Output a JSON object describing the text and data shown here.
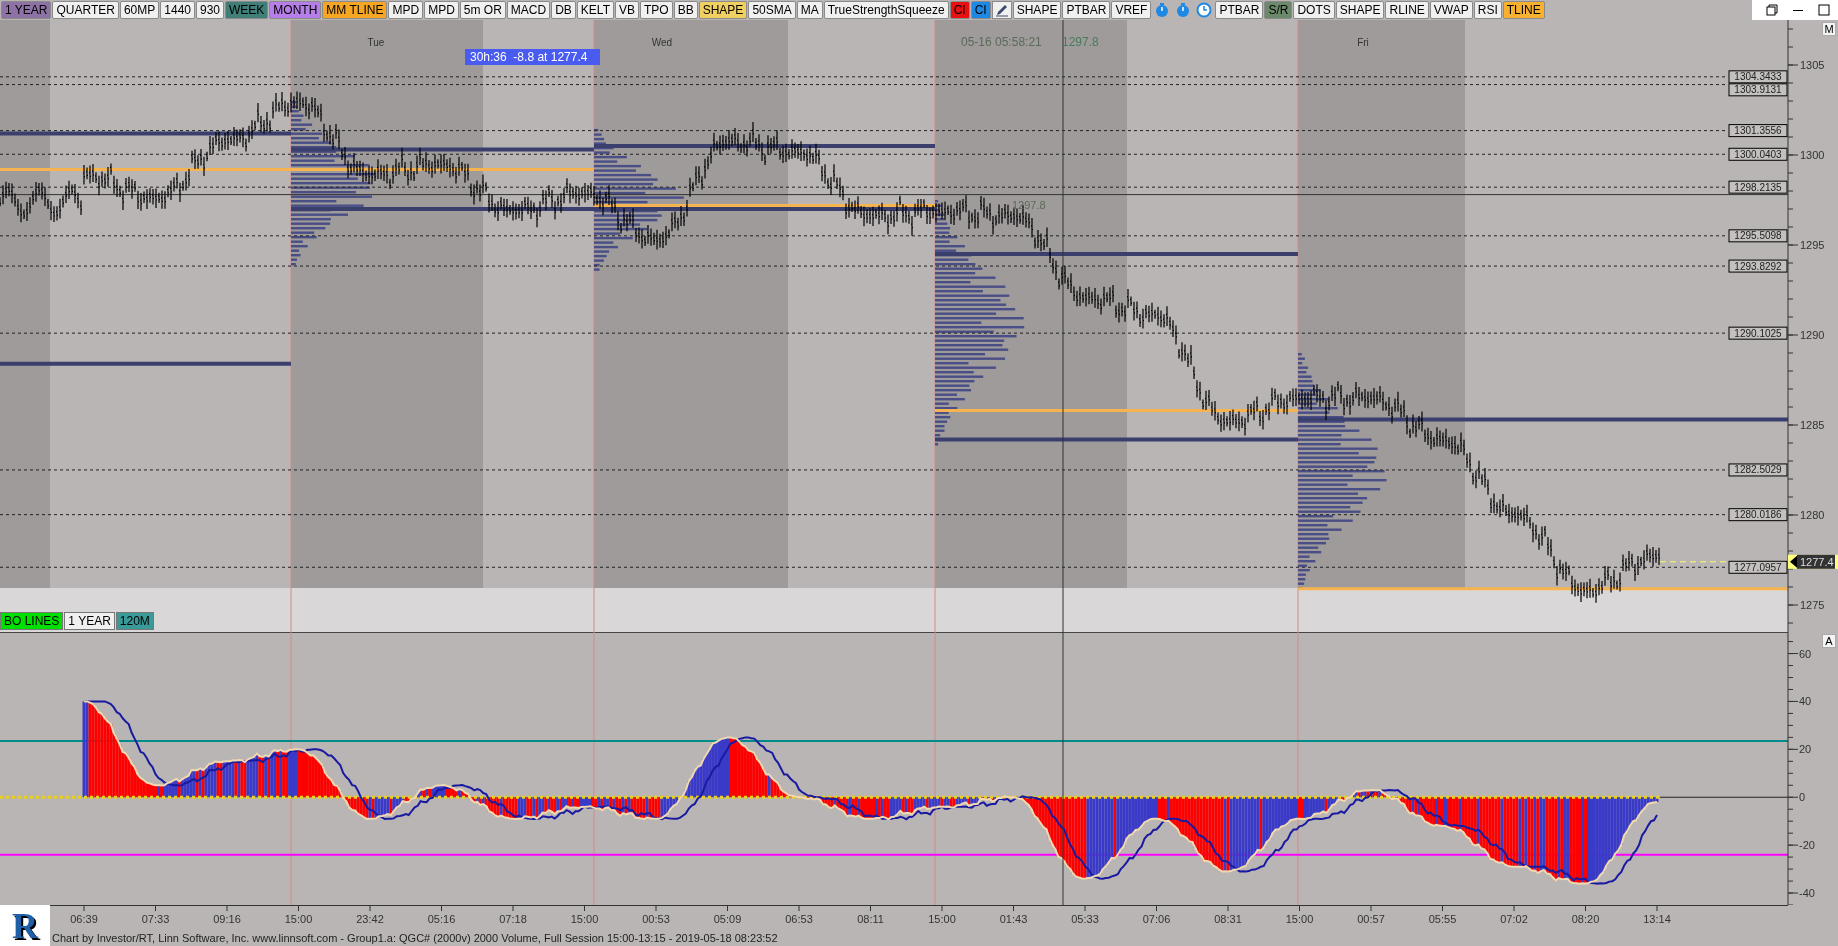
{
  "toolbar": [
    {
      "kind": "button",
      "label": "1 YEAR",
      "color": "#8e72a6"
    },
    {
      "kind": "button",
      "label": "QUARTER",
      "color": "#f0f0f0"
    },
    {
      "kind": "button",
      "label": "60MP",
      "color": "#f0f0f0"
    },
    {
      "kind": "button",
      "label": "1440",
      "color": "#f0f0f0"
    },
    {
      "kind": "button",
      "label": "930",
      "color": "#f0f0f0"
    },
    {
      "kind": "button",
      "label": "WEEK",
      "color": "#3f7f78"
    },
    {
      "kind": "button",
      "label": "MONTH",
      "color": "#b57ee8"
    },
    {
      "kind": "button",
      "label": "MM TLINE",
      "color": "#f6a623"
    },
    {
      "kind": "button",
      "label": "MPD",
      "color": "#f0f0f0"
    },
    {
      "kind": "button",
      "label": "MPD",
      "color": "#f0f0f0"
    },
    {
      "kind": "button",
      "label": "5m OR",
      "color": "#f0f0f0"
    },
    {
      "kind": "button",
      "label": "MACD",
      "color": "#f0f0f0"
    },
    {
      "kind": "button",
      "label": "DB",
      "color": "#f0f0f0"
    },
    {
      "kind": "button",
      "label": "KELT",
      "color": "#f0f0f0"
    },
    {
      "kind": "button",
      "label": "VB",
      "color": "#f0f0f0"
    },
    {
      "kind": "button",
      "label": "TPO",
      "color": "#f0f0f0"
    },
    {
      "kind": "button",
      "label": "BB",
      "color": "#f0f0f0"
    },
    {
      "kind": "button",
      "label": "SHAPE",
      "color": "#f0d060"
    },
    {
      "kind": "button",
      "label": "50SMA",
      "color": "#f0f0f0"
    },
    {
      "kind": "button",
      "label": "MA",
      "color": "#f0f0f0"
    },
    {
      "kind": "button",
      "label": "TrueStrengthSqueeze",
      "color": "#f0f0f0"
    },
    {
      "kind": "button",
      "label": "CI",
      "color": "#e81010"
    },
    {
      "kind": "button",
      "label": "CI",
      "color": "#1e88e5"
    },
    {
      "kind": "draw-tool"
    },
    {
      "kind": "button",
      "label": "SHAPE",
      "color": "#f0f0f0"
    },
    {
      "kind": "button",
      "label": "PTBAR",
      "color": "#f0f0f0"
    },
    {
      "kind": "button",
      "label": "VREF",
      "color": "#f0f0f0"
    },
    {
      "kind": "timer"
    },
    {
      "kind": "timer"
    },
    {
      "kind": "clock"
    },
    {
      "kind": "button",
      "label": "PTBAR",
      "color": "#f0f0f0"
    },
    {
      "kind": "button",
      "label": "S/R",
      "color": "#6b8a6b"
    },
    {
      "kind": "button",
      "label": "DOTS",
      "color": "#f0f0f0"
    },
    {
      "kind": "button",
      "label": "SHAPE",
      "color": "#f0f0f0"
    },
    {
      "kind": "button",
      "label": "RLINE",
      "color": "#f0f0f0"
    },
    {
      "kind": "button",
      "label": "VWAP",
      "color": "#f0f0f0"
    },
    {
      "kind": "button",
      "label": "RSI",
      "color": "#f0f0f0"
    },
    {
      "kind": "button",
      "label": "TLINE",
      "color": "#f7b030"
    }
  ],
  "price_panel": {
    "day_labels": [
      "Tue",
      "Wed",
      "Fri"
    ],
    "session_stats": "30h:36  -8.8 at 1277.4",
    "cursor_time": "05-16 05:58:21",
    "cursor_price": "1297.8",
    "crosshair_label": "1297.8",
    "corner_button": "M",
    "legend": [
      {
        "label": "BO LINES",
        "color": "#00e000"
      },
      {
        "label": "1 YEAR",
        "color": "#f0f0f0"
      },
      {
        "label": "120M",
        "color": "#3a9a98"
      }
    ],
    "price_axis": [
      "1305",
      "1300",
      "1295",
      "1290",
      "1285",
      "1280",
      "1275"
    ],
    "price_levels": [
      {
        "label": "1304.3433"
      },
      {
        "label": "1303.9131"
      },
      {
        "label": "1301.3556"
      },
      {
        "label": "1300.0403"
      },
      {
        "label": "1298.2135"
      },
      {
        "label": "1295.5098"
      },
      {
        "label": "1293.8292"
      },
      {
        "label": "1290.1025"
      },
      {
        "label": "1282.5029"
      },
      {
        "label": "1280.0186"
      },
      {
        "label": "1277.0957"
      }
    ],
    "current_price": "1277.4"
  },
  "indicator_panel": {
    "corner_button": "A",
    "value_axis": [
      "60",
      "40",
      "20",
      "0",
      "-20",
      "-40"
    ]
  },
  "time_axis": [
    "06:39",
    "07:33",
    "09:16",
    "15:00",
    "23:42",
    "05:16",
    "07:18",
    "15:00",
    "00:53",
    "05:09",
    "06:53",
    "08:11",
    "15:00",
    "01:43",
    "05:33",
    "07:06",
    "08:31",
    "15:00",
    "00:57",
    "05:55",
    "07:02",
    "08:20",
    "13:14"
  ],
  "logo": "R",
  "status_bar": "Chart by Investor/RT, Linn Software, Inc. www.linnsoft.com - Group1.a: QGC# (2000v) 2000 Volume, Full Session 15:00-13:15 - 2019-05-18 08:23:52"
}
